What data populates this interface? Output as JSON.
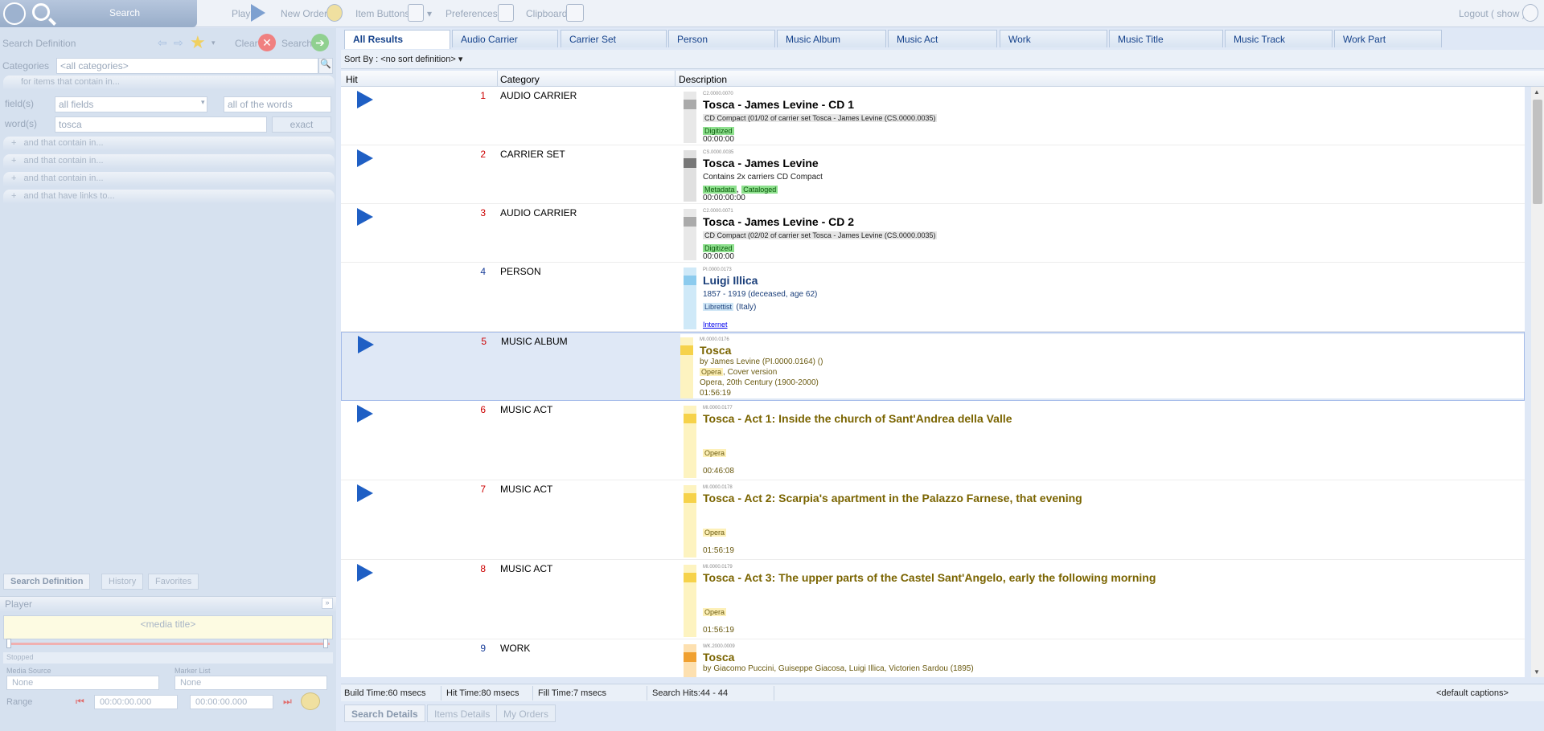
{
  "toolbar": {
    "search_label": "Search",
    "play_label": "Play",
    "new_order_label": "New Order",
    "item_buttons_label": "Item Buttons",
    "preferences_label": "Preferences",
    "clipboard_label": "Clipboard",
    "logout_label": "Logout ( show )"
  },
  "search_panel": {
    "title": "Search Definition",
    "clear_label": "Clear",
    "search_label": "Search",
    "categories_label": "Categories",
    "categories_value": "<all categories>",
    "for_items_label": "for items that contain in...",
    "fields_label": "field(s)",
    "fields_value": "all fields",
    "words_mode": "all of the words",
    "words_label": "word(s)",
    "words_value": "tosca",
    "match_mode": "exact",
    "conditions": [
      "and that contain in...",
      "and that contain in...",
      "and that contain in...",
      "and that have links to..."
    ],
    "bottom_tabs": [
      "Search Definition",
      "History",
      "Favorites"
    ]
  },
  "player": {
    "title": "Player",
    "media_title": "<media title>",
    "status": "Stopped",
    "media_source_label": "Media Source",
    "media_source_value": "None",
    "marker_list_label": "Marker List",
    "marker_list_value": "None",
    "range_label": "Range",
    "range_start": "00:00:00.000",
    "range_end": "00:00:00.000"
  },
  "tabs": [
    "All Results",
    "Audio Carrier",
    "Carrier Set",
    "Person",
    "Music Album",
    "Music Act",
    "Work",
    "Music Title",
    "Music Track",
    "Work Part"
  ],
  "sort": {
    "label": "Sort By :",
    "value": "<no sort definition>"
  },
  "grid": {
    "headers": {
      "hit": "Hit",
      "category": "Category",
      "description": "Description"
    },
    "rows": [
      {
        "num": "1",
        "category": "AUDIO CARRIER",
        "code": "C2.0000.0070",
        "title": "Tosca - James Levine - CD 1",
        "line1": "CD Compact (01/02 of carrier set Tosca - James Levine (CS.0000.0035)",
        "tags": [
          "Digitized"
        ],
        "time": "00:00:00"
      },
      {
        "num": "2",
        "category": "CARRIER SET",
        "code": "CS.0000.0035",
        "title": "Tosca - James Levine",
        "line1": "Contains 2x carriers CD Compact",
        "tags": [
          "Metadata",
          "Cataloged"
        ],
        "time": "00:00:00:00"
      },
      {
        "num": "3",
        "category": "AUDIO CARRIER",
        "code": "C2.0000.0071",
        "title": "Tosca - James Levine - CD 2",
        "line1": "CD Compact (02/02 of carrier set Tosca - James Levine (CS.0000.0035)",
        "tags": [
          "Digitized"
        ],
        "time": "00:00:00"
      },
      {
        "num": "4",
        "category": "PERSON",
        "code": "PI.0000.0173",
        "title": "Luigi Illica",
        "line1": "1857 - 1919 (deceased, age 62)",
        "role": "Librettist",
        "country": "(Italy)",
        "link": "Internet"
      },
      {
        "num": "5",
        "category": "MUSIC ALBUM",
        "code": "MI.0000.0176",
        "title": "Tosca",
        "line1": "by James Levine (PI.0000.0164) ()",
        "tags": [
          "Opera",
          ", Cover version"
        ],
        "line2": "Opera, 20th Century (1900-2000)",
        "time": "01:56:19"
      },
      {
        "num": "6",
        "category": "MUSIC ACT",
        "code": "MI.0000.0177",
        "title": "Tosca - Act 1: Inside the church of Sant'Andrea della Valle",
        "tags": [
          "Opera"
        ],
        "time": "00:46:08"
      },
      {
        "num": "7",
        "category": "MUSIC ACT",
        "code": "MI.0000.0178",
        "title": "Tosca - Act 2: Scarpia's apartment in the Palazzo Farnese, that evening",
        "tags": [
          "Opera"
        ],
        "time": "01:56:19"
      },
      {
        "num": "8",
        "category": "MUSIC ACT",
        "code": "MI.0000.0179",
        "title": "Tosca - Act 3: The upper parts of the Castel Sant'Angelo, early the following morning",
        "tags": [
          "Opera"
        ],
        "time": "01:56:19"
      },
      {
        "num": "9",
        "category": "WORK",
        "code": "WK.2000.0009",
        "title": "Tosca",
        "line1": "by Giacomo Puccini, Guiseppe Giacosa, Luigi Illica, Victorien Sardou (1895)"
      }
    ]
  },
  "status": {
    "build": "Build Time:60 msecs",
    "hit": "Hit Time:80 msecs",
    "fill": "Fill Time:7 msecs",
    "hits": "Search Hits:44 - 44",
    "captions": "<default captions>"
  },
  "bottom_tabs": [
    "Search Details",
    "Items Details",
    "My Orders"
  ],
  "colors": {
    "accent": "#1f5fc4",
    "panel": "#d6e1ef",
    "tag_green": "#8ee08e",
    "gold_text": "#7a6400"
  }
}
